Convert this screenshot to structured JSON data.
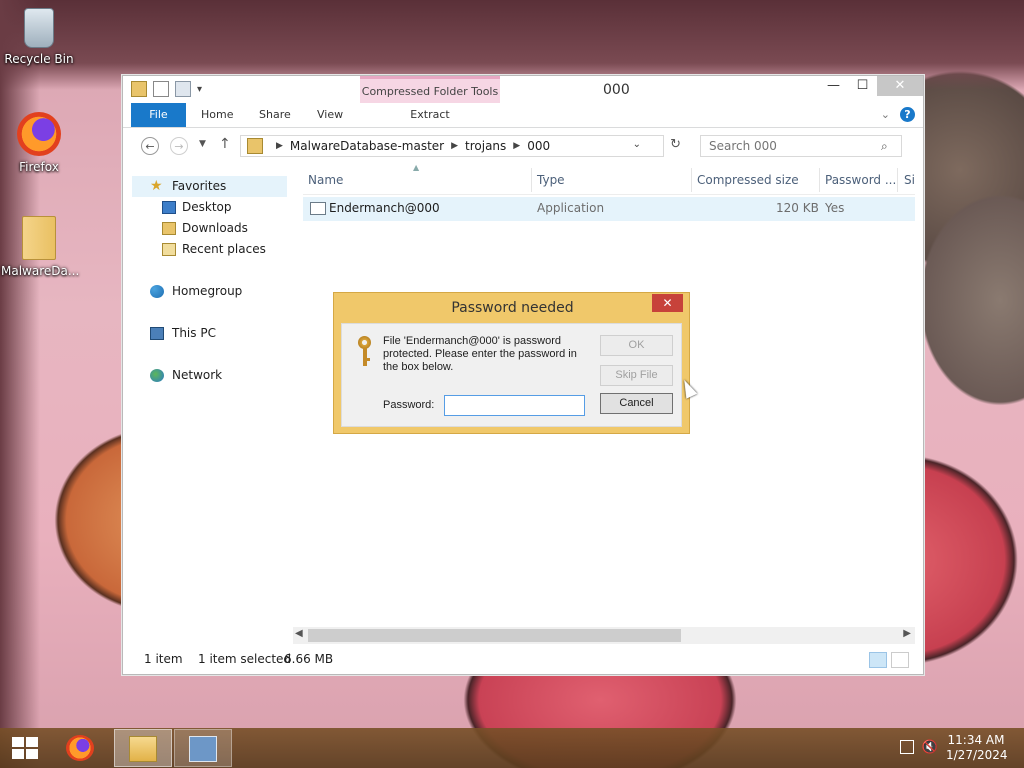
{
  "desktop": {
    "icons": [
      {
        "label": "Recycle Bin"
      },
      {
        "label": "Firefox"
      },
      {
        "label": "MalwareDa..."
      }
    ]
  },
  "explorer": {
    "title": "000",
    "context_tab": "Compressed Folder Tools",
    "ribbon_tabs": {
      "file": "File",
      "home": "Home",
      "share": "Share",
      "view": "View",
      "extract": "Extract"
    },
    "breadcrumb": [
      "MalwareDatabase-master",
      "trojans",
      "000"
    ],
    "search_placeholder": "Search 000",
    "nav": {
      "favorites": "Favorites",
      "desktop": "Desktop",
      "downloads": "Downloads",
      "recent": "Recent places",
      "homegroup": "Homegroup",
      "thispc": "This PC",
      "network": "Network"
    },
    "columns": {
      "name": "Name",
      "type": "Type",
      "size": "Compressed size",
      "password": "Password ...",
      "more": "Si"
    },
    "rows": [
      {
        "name": "Endermanch@000",
        "type": "Application",
        "size": "120 KB",
        "password": "Yes"
      }
    ],
    "status": {
      "count": "1 item",
      "selected": "1 item selected",
      "size": "6.66 MB"
    }
  },
  "dialog": {
    "title": "Password needed",
    "message": "File 'Endermanch@000' is password protected.  Please enter the password in the box below.",
    "password_label": "Password:",
    "password_value": "",
    "ok": "OK",
    "skip": "Skip File",
    "cancel": "Cancel"
  },
  "taskbar": {
    "time": "11:34 AM",
    "date": "1/27/2024"
  },
  "colors": {
    "accent": "#1979ca",
    "dialog_frame": "#f0c86a",
    "close_red": "#c7423a"
  }
}
